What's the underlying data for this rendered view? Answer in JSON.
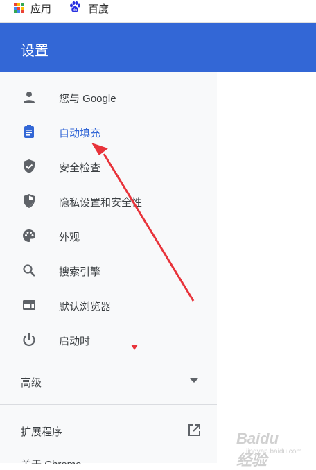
{
  "bookmarks_bar": {
    "items": [
      {
        "label": "应用",
        "icon": "apps-grid-icon"
      },
      {
        "label": "百度",
        "icon": "baidu-paw-icon"
      }
    ]
  },
  "header": {
    "title": "设置"
  },
  "sidebar": {
    "items": [
      {
        "label": "您与 Google",
        "icon": "person-icon",
        "active": false
      },
      {
        "label": "自动填充",
        "icon": "clipboard-icon",
        "active": true
      },
      {
        "label": "安全检查",
        "icon": "shield-check-icon",
        "active": false
      },
      {
        "label": "隐私设置和安全性",
        "icon": "shield-icon",
        "active": false
      },
      {
        "label": "外观",
        "icon": "palette-icon",
        "active": false
      },
      {
        "label": "搜索引擎",
        "icon": "search-icon",
        "active": false
      },
      {
        "label": "默认浏览器",
        "icon": "browser-icon",
        "active": false
      },
      {
        "label": "启动时",
        "icon": "power-icon",
        "active": false
      }
    ],
    "advanced": {
      "label": "高级"
    },
    "extensions": {
      "label": "扩展程序",
      "icon": "open-in-new-icon"
    },
    "about": {
      "label": "关于 Chrome"
    }
  },
  "watermark": {
    "brand": "Baidu经验",
    "sub": "jingyan.baidu.com"
  },
  "colors": {
    "header_bg": "#3367d6",
    "active_text": "#3367d6",
    "sidebar_bg": "#f8f9fa",
    "icon_gray": "#5f6368",
    "annotation_red": "#e8333a"
  }
}
